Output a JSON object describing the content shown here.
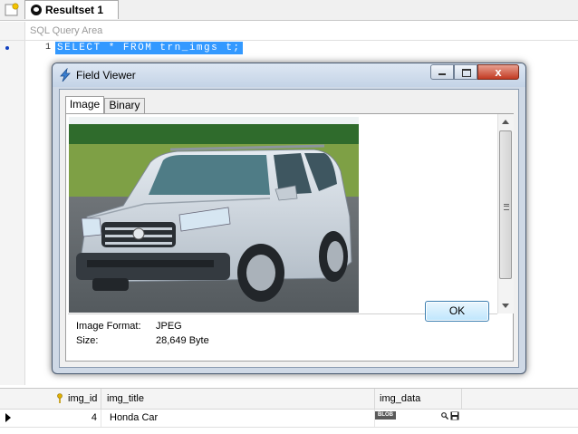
{
  "tabs": [
    {
      "label": "Resultset 1"
    }
  ],
  "query_area": {
    "title": "SQL Query Area"
  },
  "editor": {
    "line_number": "1",
    "code": "SELECT * FROM trn_imgs t;"
  },
  "dialog": {
    "title": "Field Viewer",
    "close_glyph": "x",
    "tabs": [
      {
        "label": "Image"
      },
      {
        "label": "Binary"
      }
    ],
    "image_format_label": "Image Format:",
    "image_format_value": "JPEG",
    "size_label": "Size:",
    "size_value": "28,649 Byte",
    "ok_label": "OK"
  },
  "grid": {
    "columns": [
      "img_id",
      "img_title",
      "img_data"
    ],
    "rows": [
      {
        "img_id": "4",
        "img_title": "Honda Car",
        "img_data": "BLOB"
      }
    ]
  },
  "icons": {
    "new_tab": "new-tab-icon",
    "resultset": "resultset-icon",
    "field_viewer": "lightning-icon",
    "key": "key-icon",
    "view": "magnifier-icon",
    "save": "save-icon"
  },
  "colors": {
    "selection": "#3399ff",
    "close_button": "#c23a22",
    "ok_button_border": "#3c7fb1"
  }
}
